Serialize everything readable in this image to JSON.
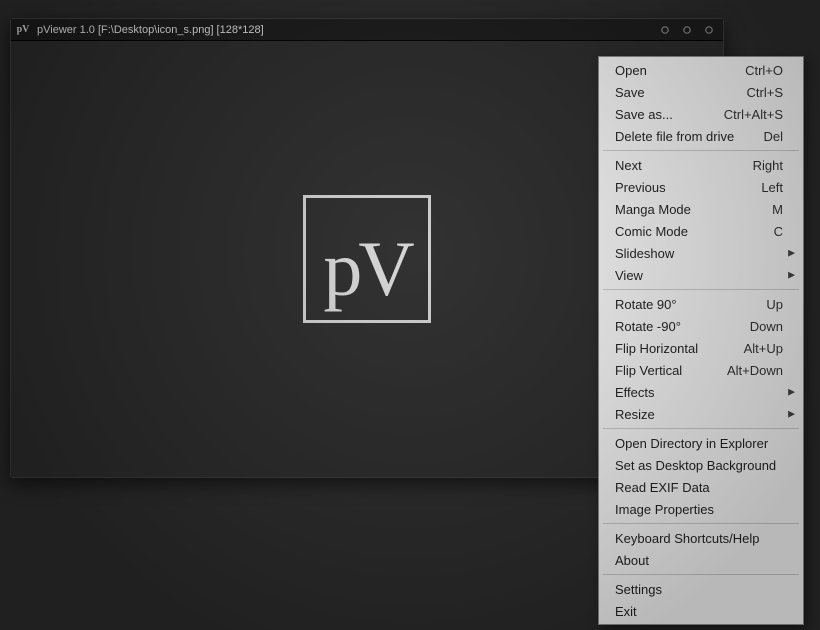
{
  "window": {
    "app_icon_text": "pV",
    "title": "pViewer 1.0 [F:\\Desktop\\icon_s.png] [128*128]",
    "logo_text": "pV"
  },
  "menu": {
    "groups": [
      [
        {
          "label": "Open",
          "shortcut": "Ctrl+O",
          "submenu": false
        },
        {
          "label": "Save",
          "shortcut": "Ctrl+S",
          "submenu": false
        },
        {
          "label": "Save as...",
          "shortcut": "Ctrl+Alt+S",
          "submenu": false
        },
        {
          "label": "Delete file from drive",
          "shortcut": "Del",
          "submenu": false
        }
      ],
      [
        {
          "label": "Next",
          "shortcut": "Right",
          "submenu": false
        },
        {
          "label": "Previous",
          "shortcut": "Left",
          "submenu": false
        },
        {
          "label": "Manga Mode",
          "shortcut": "M",
          "submenu": false
        },
        {
          "label": "Comic Mode",
          "shortcut": "C",
          "submenu": false
        },
        {
          "label": "Slideshow",
          "shortcut": "",
          "submenu": true
        },
        {
          "label": "View",
          "shortcut": "",
          "submenu": true
        }
      ],
      [
        {
          "label": "Rotate 90°",
          "shortcut": "Up",
          "submenu": false
        },
        {
          "label": "Rotate -90°",
          "shortcut": "Down",
          "submenu": false
        },
        {
          "label": "Flip Horizontal",
          "shortcut": "Alt+Up",
          "submenu": false
        },
        {
          "label": "Flip Vertical",
          "shortcut": "Alt+Down",
          "submenu": false
        },
        {
          "label": "Effects",
          "shortcut": "",
          "submenu": true
        },
        {
          "label": "Resize",
          "shortcut": "",
          "submenu": true
        }
      ],
      [
        {
          "label": "Open Directory in Explorer",
          "shortcut": "",
          "submenu": false
        },
        {
          "label": "Set as Desktop Background",
          "shortcut": "",
          "submenu": false
        },
        {
          "label": "Read EXIF Data",
          "shortcut": "",
          "submenu": false
        },
        {
          "label": "Image Properties",
          "shortcut": "",
          "submenu": false
        }
      ],
      [
        {
          "label": "Keyboard Shortcuts/Help",
          "shortcut": "",
          "submenu": false
        },
        {
          "label": "About",
          "shortcut": "",
          "submenu": false
        }
      ],
      [
        {
          "label": "Settings",
          "shortcut": "",
          "submenu": false
        },
        {
          "label": "Exit",
          "shortcut": "",
          "submenu": false
        }
      ]
    ]
  }
}
